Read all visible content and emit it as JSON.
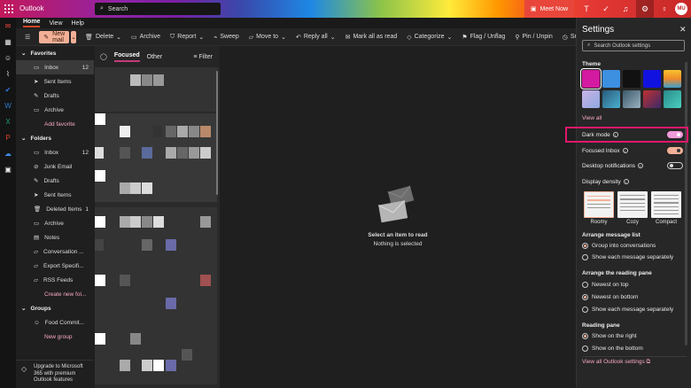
{
  "app": {
    "name": "Outlook"
  },
  "search": {
    "placeholder": "Search"
  },
  "header": {
    "meet_now": "Meet Now",
    "avatar_initials": "MU"
  },
  "menu": [
    "Home",
    "View",
    "Help"
  ],
  "toolbar": {
    "new_mail": "New mail",
    "delete": "Delete",
    "archive": "Archive",
    "report": "Report",
    "sweep": "Sweep",
    "move_to": "Move to",
    "reply_all": "Reply all",
    "mark_all_read": "Mark all as read",
    "categorize": "Categorize",
    "flag": "Flag / Unflag",
    "pin": "Pin / Unpin",
    "snooze": "Snooze"
  },
  "sidebar": {
    "favorites_header": "Favorites",
    "favorites": [
      {
        "label": "Inbox",
        "count": "12"
      },
      {
        "label": "Sent Items",
        "count": ""
      },
      {
        "label": "Drafts",
        "count": ""
      },
      {
        "label": "Archive",
        "count": ""
      }
    ],
    "add_favorite": "Add favorite",
    "folders_header": "Folders",
    "folders": [
      {
        "label": "Inbox",
        "count": "12"
      },
      {
        "label": "Junk Email",
        "count": ""
      },
      {
        "label": "Drafts",
        "count": ""
      },
      {
        "label": "Sent Items",
        "count": ""
      },
      {
        "label": "Deleted Items",
        "count": "1"
      },
      {
        "label": "Archive",
        "count": ""
      },
      {
        "label": "Notes",
        "count": ""
      },
      {
        "label": "Conversation ...",
        "count": ""
      },
      {
        "label": "Export Specifi...",
        "count": ""
      },
      {
        "label": "RSS Feeds",
        "count": ""
      }
    ],
    "create_folder": "Create new fol...",
    "groups_header": "Groups",
    "groups": [
      {
        "label": "Food Commit..."
      }
    ],
    "new_group": "New group",
    "upgrade": "Upgrade to Microsoft 365 with premium Outlook features"
  },
  "message_list": {
    "tab_focused": "Focused",
    "tab_other": "Other",
    "filter": "Filter"
  },
  "reading_pane": {
    "empty_title": "Select an item to read",
    "empty_sub": "Nothing is selected"
  },
  "settings": {
    "title": "Settings",
    "search_placeholder": "Search Outlook settings",
    "theme_label": "Theme",
    "view_all": "View all",
    "dark_mode": "Dark mode",
    "dark_mode_on": true,
    "focused_inbox": "Focused Inbox",
    "focused_inbox_on": true,
    "desktop_notifications": "Desktop notifications",
    "desktop_notifications_on": false,
    "display_density": "Display density",
    "density_options": [
      "Roomy",
      "Cozy",
      "Compact"
    ],
    "density_selected": "Roomy",
    "arrange_list_label": "Arrange message list",
    "arrange_list_options": [
      "Group into conversations",
      "Show each message separately"
    ],
    "arrange_list_selected": "Group into conversations",
    "arrange_pane_label": "Arrange the reading pane",
    "arrange_pane_options": [
      "Newest on top",
      "Newest on bottom",
      "Show each message separately"
    ],
    "arrange_pane_selected": "Newest on bottom",
    "reading_pane_label": "Reading pane",
    "reading_pane_options": [
      "Show on the right",
      "Show on the bottom"
    ],
    "reading_pane_selected": "Show on the right",
    "view_all_settings": "View all Outlook settings"
  },
  "colors": {
    "accent": "#f2b097",
    "highlight": "#e0186b",
    "dark_toggle": "#f09bd9"
  }
}
